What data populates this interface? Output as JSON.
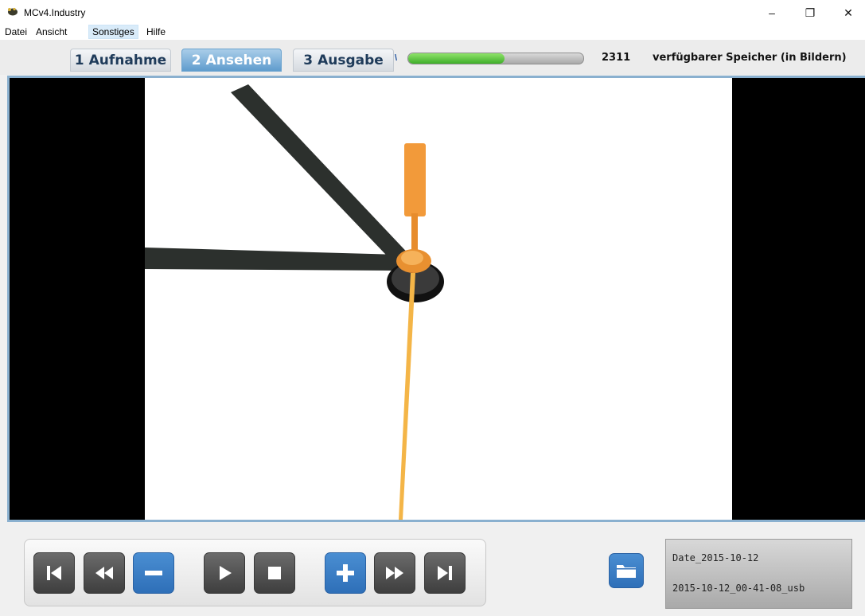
{
  "window": {
    "title": "MCv4.Industry",
    "minimize_symbol": "–",
    "restore_symbol": "❐",
    "close_symbol": "✕"
  },
  "menu": [
    {
      "label": "Datei"
    },
    {
      "label": "Ansicht"
    },
    {
      "label": "Sonstiges",
      "active": true
    },
    {
      "label": "Hilfe"
    }
  ],
  "tabs": [
    {
      "number": "1",
      "label": "Aufnahme",
      "active": false
    },
    {
      "number": "2",
      "label": "Ansehen",
      "active": true
    },
    {
      "number": "3",
      "label": "Ausgabe",
      "active": false
    }
  ],
  "memory": {
    "available_count": "2311",
    "label": "verfügbarer Speicher (in Bildern)",
    "fill_fraction": 0.55
  },
  "controls": [
    {
      "name": "first-frame",
      "icon": "skip-to-start-icon",
      "style": "gray"
    },
    {
      "name": "rewind",
      "icon": "rewind-icon",
      "style": "gray"
    },
    {
      "name": "step-back",
      "icon": "minus-icon",
      "style": "blue"
    },
    {
      "name": "play",
      "icon": "play-icon",
      "style": "gray"
    },
    {
      "name": "stop",
      "icon": "stop-icon",
      "style": "gray"
    },
    {
      "name": "step-forward",
      "icon": "plus-icon",
      "style": "blue"
    },
    {
      "name": "fast-forward",
      "icon": "fast-forward-icon",
      "style": "gray"
    },
    {
      "name": "last-frame",
      "icon": "skip-to-end-icon",
      "style": "gray"
    }
  ],
  "folder_button": {
    "icon": "folder-icon"
  },
  "session_info": {
    "date_folder": "Date_2015-10-12",
    "session_name": "2015-10-12_00-41-08_usb"
  },
  "colors": {
    "active_tab": "#5f9ccd",
    "progress_fill": "#3fae2a",
    "action_blue": "#2e6fb8",
    "clock_hands_dark": "#2c302d",
    "clock_hand_orange": "#f29a3a"
  }
}
